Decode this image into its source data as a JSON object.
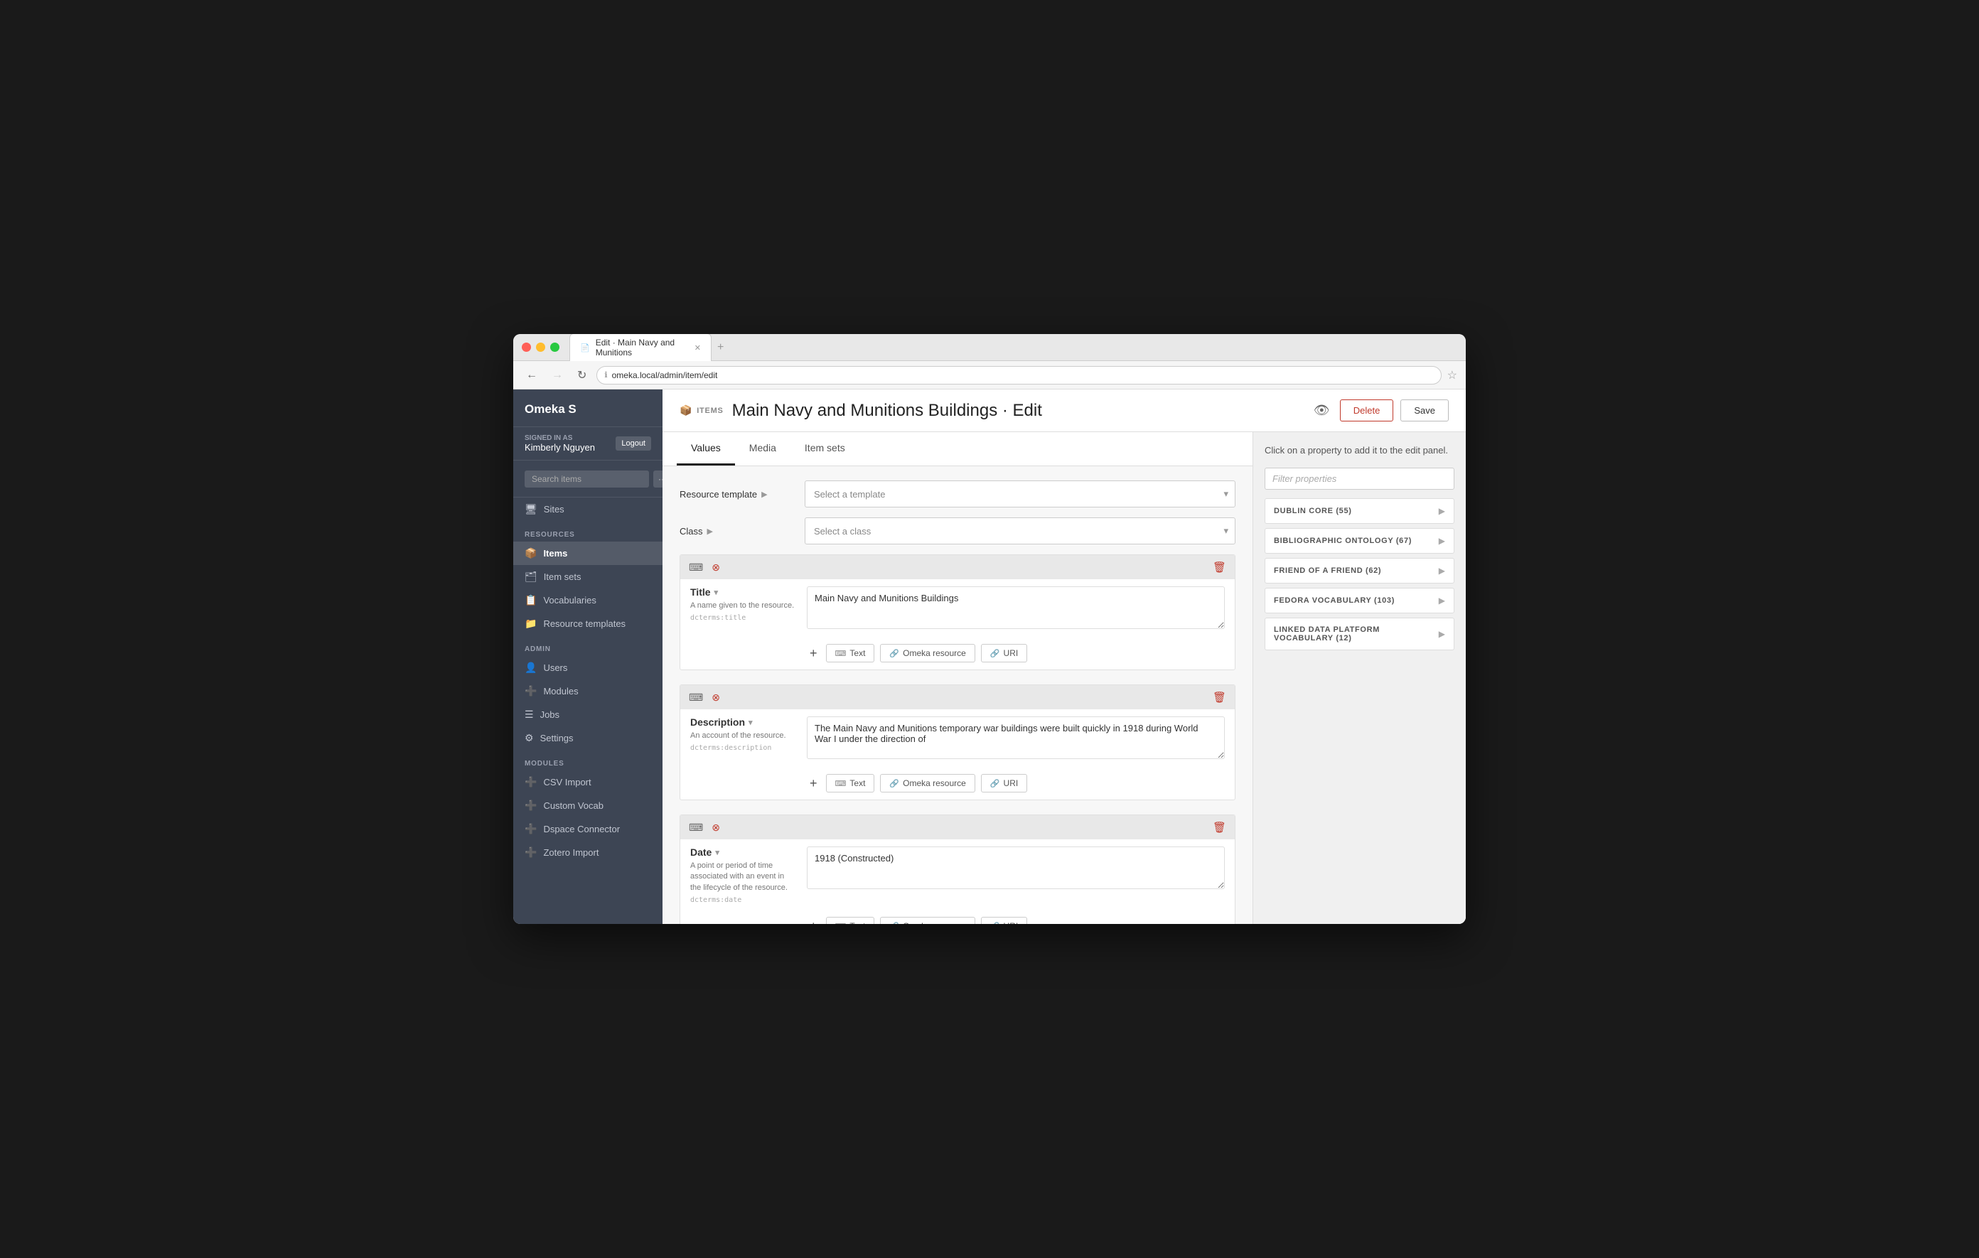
{
  "window": {
    "tab_title": "Edit · Main Navy and Munitions",
    "address": "omeka.local/admin/item/edit"
  },
  "sidebar": {
    "brand": "Omeka S",
    "signed_in_label": "SIGNED IN AS",
    "user_name": "Kimberly Nguyen",
    "logout_label": "Logout",
    "search_placeholder": "Search items",
    "sites_label": "Sites",
    "resources_label": "RESOURCES",
    "items_label": "Items",
    "item_sets_label": "Item sets",
    "vocabularies_label": "Vocabularies",
    "resource_templates_label": "Resource templates",
    "admin_label": "ADMIN",
    "users_label": "Users",
    "modules_label": "Modules",
    "jobs_label": "Jobs",
    "settings_label": "Settings",
    "modules_section_label": "MODULES",
    "csv_import_label": "CSV Import",
    "custom_vocab_label": "Custom Vocab",
    "dspace_connector_label": "Dspace Connector",
    "zotero_import_label": "Zotero Import"
  },
  "header": {
    "items_badge": "ITEMS",
    "page_title": "Main Navy and Munitions Buildings · Edit",
    "delete_label": "Delete",
    "save_label": "Save"
  },
  "tabs": {
    "values_label": "Values",
    "media_label": "Media",
    "item_sets_label": "Item sets"
  },
  "form": {
    "resource_template_label": "Resource template",
    "resource_template_placeholder": "Select a template",
    "class_label": "Class",
    "class_placeholder": "Select a class"
  },
  "properties": [
    {
      "name": "Title",
      "description": "A name given to the resource.",
      "term": "dcterms:title",
      "value": "Main Navy and Munitions Buildings",
      "add_text": "Text",
      "add_omeka": "Omeka resource",
      "add_uri": "URI"
    },
    {
      "name": "Description",
      "description": "An account of the resource.",
      "term": "dcterms:description",
      "value": "The Main Navy and Munitions temporary war buildings were built quickly in 1918 during World War I under the direction of",
      "add_text": "Text",
      "add_omeka": "Omeka resource",
      "add_uri": "URI"
    },
    {
      "name": "Date",
      "description": "A point or period of time associated with an event in the lifecycle of the resource.",
      "term": "dcterms:date",
      "value": "1918 (Constructed)",
      "add_text": "Text",
      "add_omeka": "Omeka resource",
      "add_uri": "URI"
    }
  ],
  "right_panel": {
    "instruction": "Click on a property to add it to the edit panel.",
    "filter_placeholder": "Filter properties",
    "ontologies": [
      {
        "label": "DUBLIN CORE (55)"
      },
      {
        "label": "BIBLIOGRAPHIC ONTOLOGY (67)"
      },
      {
        "label": "FRIEND OF A FRIEND (62)"
      },
      {
        "label": "FEDORA VOCABULARY (103)"
      },
      {
        "label": "LINKED DATA PLATFORM VOCABULARY (12)"
      }
    ]
  }
}
